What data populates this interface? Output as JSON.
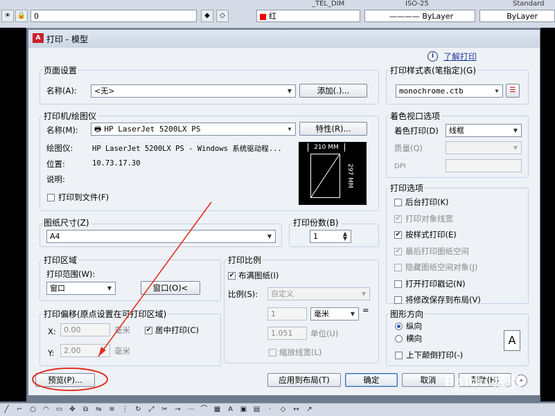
{
  "toolbar": {
    "layer_name": "0",
    "dimstyle": "_TEL_DIM",
    "text_scale": "ISO-25",
    "text_style": "Standard",
    "color": "红",
    "linetype": "ByLayer",
    "lineweight": "ByLayer"
  },
  "dialog": {
    "title": "打印 - 模型",
    "help_link": "了解打印",
    "page_setup": {
      "label": "页面设置",
      "name_label": "名称(A):",
      "name_value": "<无>",
      "add_button": "添加(.)..."
    },
    "printer": {
      "label": "打印机/绘图仪",
      "name_label": "名称(M):",
      "name_value": "HP LaserJet 5200LX PS",
      "properties_button": "特性(R)...",
      "plotter_label": "绘图仪:",
      "plotter_value": "HP LaserJet 5200LX PS - Windows 系统驱动程...",
      "location_label": "位置:",
      "location_value": "10.73.17.30",
      "description_label": "说明:",
      "print_to_file": "打印到文件(F)",
      "preview_width": "210 MM",
      "preview_height": "297 MM"
    },
    "paper": {
      "label": "图纸尺寸(Z)",
      "value": "A4"
    },
    "copies": {
      "label": "打印份数(B)",
      "value": "1"
    },
    "area": {
      "label": "打印区域",
      "range_label": "打印范围(W):",
      "range_value": "窗口",
      "window_button": "窗口(O)<"
    },
    "offset": {
      "label": "打印偏移(原点设置在可打印区域)",
      "x_label": "X:",
      "x_value": "0.00",
      "x_unit": "毫米",
      "y_label": "Y:",
      "y_value": "2.00",
      "y_unit": "毫米",
      "center": "居中打印(C)"
    },
    "scale": {
      "label": "打印比例",
      "fit": "布满图纸(I)",
      "ratio_label": "比例(S):",
      "ratio_value": "自定义",
      "value1": "1",
      "unit_value": "毫米",
      "equals": "=",
      "value2": "1.051",
      "unit_label": "单位(U)",
      "lineweights": "缩放线宽(L)"
    },
    "style_table": {
      "label": "打印样式表(笔指定)(G)",
      "value": "monochrome.ctb"
    },
    "shaded": {
      "label": "着色视口选项",
      "shade_label": "着色打印(D)",
      "shade_value": "线框",
      "quality_label": "质量(Q)",
      "dpi_label": "DPI"
    },
    "options": {
      "label": "打印选项",
      "items": [
        {
          "text": "后台打印(K)",
          "checked": false,
          "disabled": false
        },
        {
          "text": "打印对象线宽",
          "checked": true,
          "disabled": true
        },
        {
          "text": "按样式打印(E)",
          "checked": true,
          "disabled": false
        },
        {
          "text": "最后打印图纸空间",
          "checked": true,
          "disabled": true
        },
        {
          "text": "隐藏图纸空间对象(J)",
          "checked": false,
          "disabled": true
        },
        {
          "text": "打开打印戳记(N)",
          "checked": false,
          "disabled": false
        },
        {
          "text": "将修改保存到布局(V)",
          "checked": false,
          "disabled": false
        }
      ]
    },
    "orientation": {
      "label": "图形方向",
      "portrait": "纵向",
      "landscape": "横向",
      "upside": "上下颠倒打印(-)",
      "icon_letter": "A"
    },
    "buttons": {
      "preview": "预览(P)...",
      "apply": "应用到布局(T)",
      "ok": "确定",
      "cancel": "取消",
      "help": "帮助(H)"
    },
    "watermark": "Baidu 经验",
    "watermark_url": "jingyan.baidu.com"
  },
  "colors": {
    "accent": "#1f5fc0",
    "annotation": "#e03020",
    "background": "#000000"
  }
}
